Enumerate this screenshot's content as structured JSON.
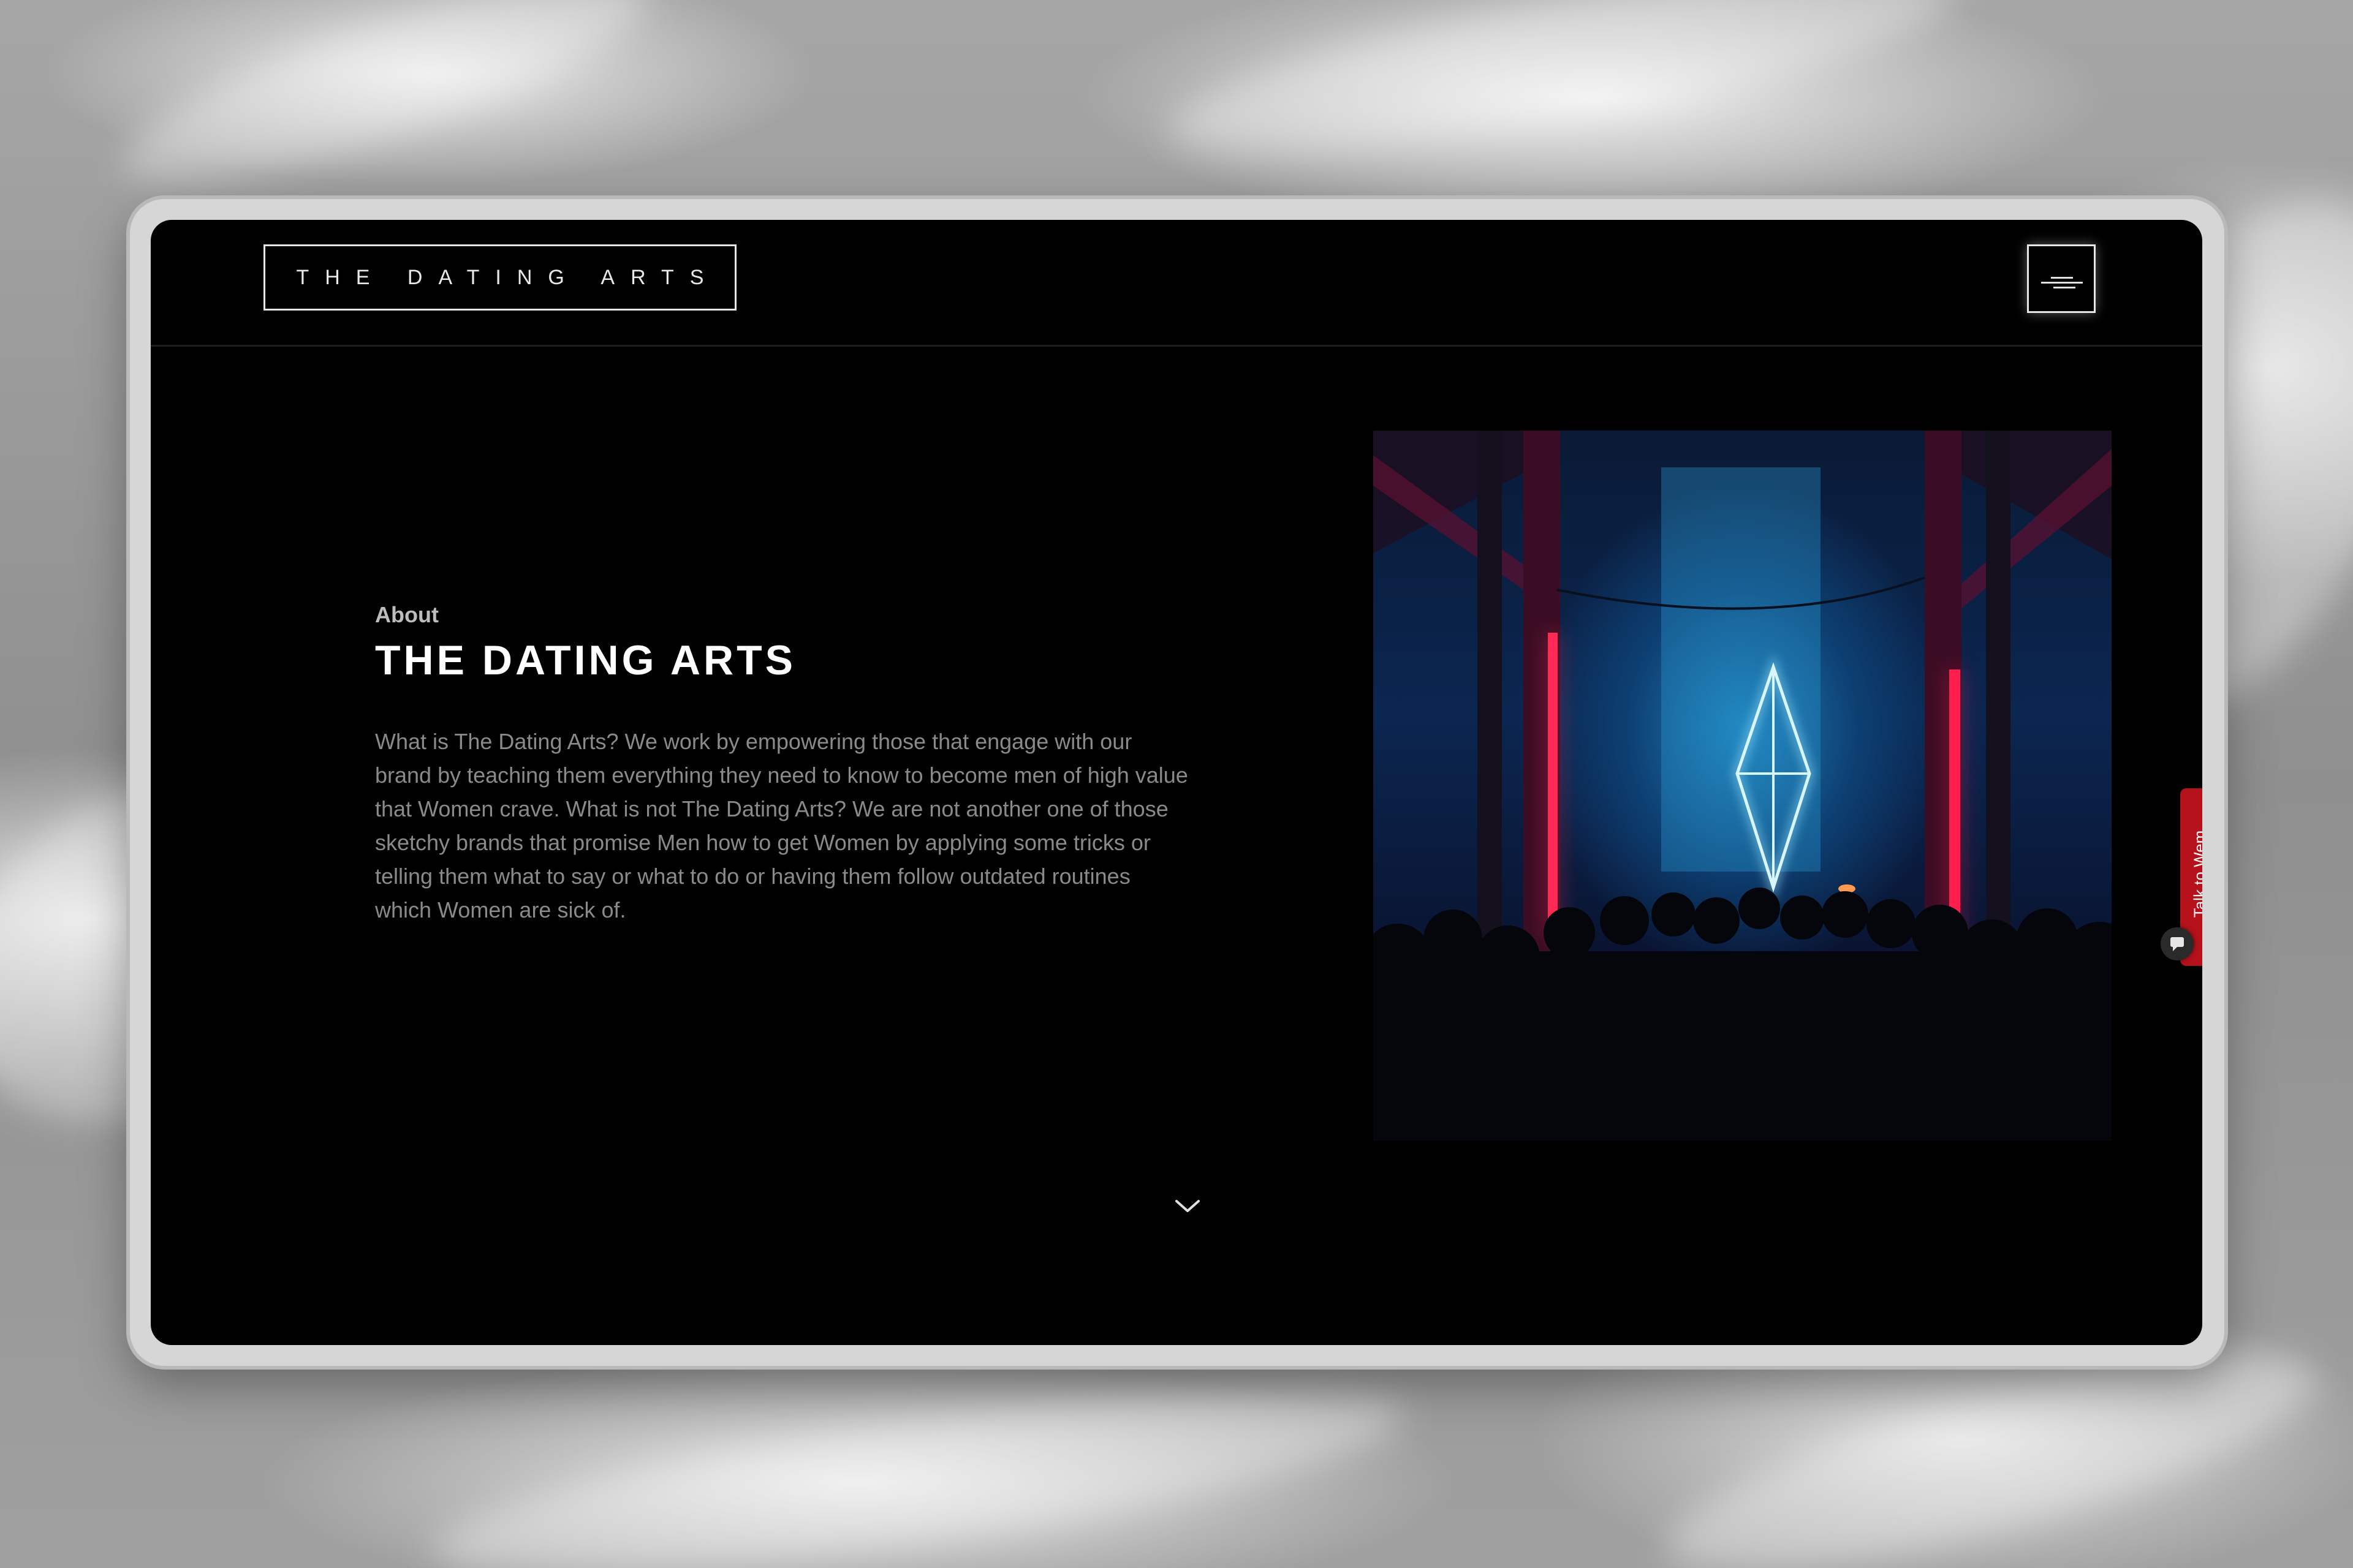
{
  "header": {
    "logo_text": "THE DATING ARTS"
  },
  "about": {
    "label": "About",
    "title": "THE DATING ARTS",
    "body": "What is The Dating Arts? We work by empowering those that engage with our brand by teaching them everything they need to know to become men of high value that Women crave. What is not The Dating Arts? We are not another one of those sketchy brands that promise Men how to get Women by applying some tricks or telling them what to say or what to do or having them follow outdated routines which Women are sick of."
  },
  "chat": {
    "tab_label": "Talk to Wem"
  },
  "colors": {
    "page_background": "#000000",
    "accent_red": "#b5121b",
    "frame": "#d6d6d6"
  },
  "icons": {
    "menu": "hamburger-menu-icon",
    "scroll": "chevron-down-icon",
    "chat": "chat-bubble-icon",
    "photo_centerpiece": "neon-diamond-icon"
  }
}
